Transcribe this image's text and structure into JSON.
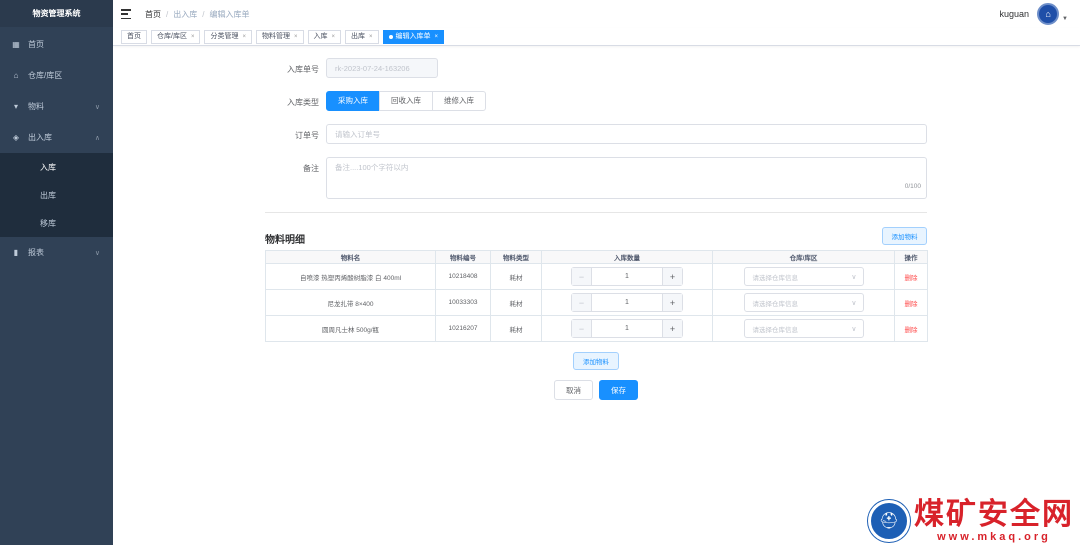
{
  "app": {
    "title": "物资管理系统"
  },
  "sidebar": {
    "items": [
      {
        "label": "首页",
        "icon": "dashboard-icon"
      },
      {
        "label": "仓库/库区",
        "icon": "warehouse-icon"
      },
      {
        "label": "物料",
        "icon": "cart-icon"
      },
      {
        "label": "出入库",
        "icon": "box-icon",
        "sub": [
          "入库",
          "出库",
          "移库"
        ]
      },
      {
        "label": "报表",
        "icon": "chart-icon"
      }
    ]
  },
  "header": {
    "breadcrumb": [
      "首页",
      "出入库",
      "编辑入库单"
    ],
    "username": "kuguan"
  },
  "tags": [
    "首页",
    "仓库/库区",
    "分类管理",
    "物料管理",
    "入库",
    "出库",
    "编辑入库单"
  ],
  "form": {
    "order_no_label": "入库单号",
    "order_no_value": "rk-2023-07-24-163206",
    "type_label": "入库类型",
    "type_options": [
      "采购入库",
      "回收入库",
      "维修入库"
    ],
    "type_selected": "采购入库",
    "po_label": "订单号",
    "po_placeholder": "请输入订单号",
    "remark_label": "备注",
    "remark_placeholder": "备注....100个字符以内",
    "remark_count": "0/100"
  },
  "materials": {
    "title": "物料明细",
    "add_label": "添加物料",
    "columns": [
      "物料名",
      "物料编号",
      "物料类型",
      "入库数量",
      "仓库/库区",
      "操作"
    ],
    "rows": [
      {
        "name": "自喷漆 热塑丙烯酸树脂漆 白 400ml",
        "code": "10218408",
        "type": "耗材",
        "qty": "1"
      },
      {
        "name": "尼龙扎带 8×400",
        "code": "10033303",
        "type": "耗材",
        "qty": "1"
      },
      {
        "name": "圆周凡士林 500g/瓶",
        "code": "10216207",
        "type": "耗材",
        "qty": "1"
      }
    ],
    "select_placeholder": "请选择仓库信息",
    "delete_label": "删除"
  },
  "actions": {
    "cancel": "取消",
    "save": "保存"
  },
  "watermark": {
    "title": "煤矿安全网",
    "url": "www.mkaq.org"
  }
}
